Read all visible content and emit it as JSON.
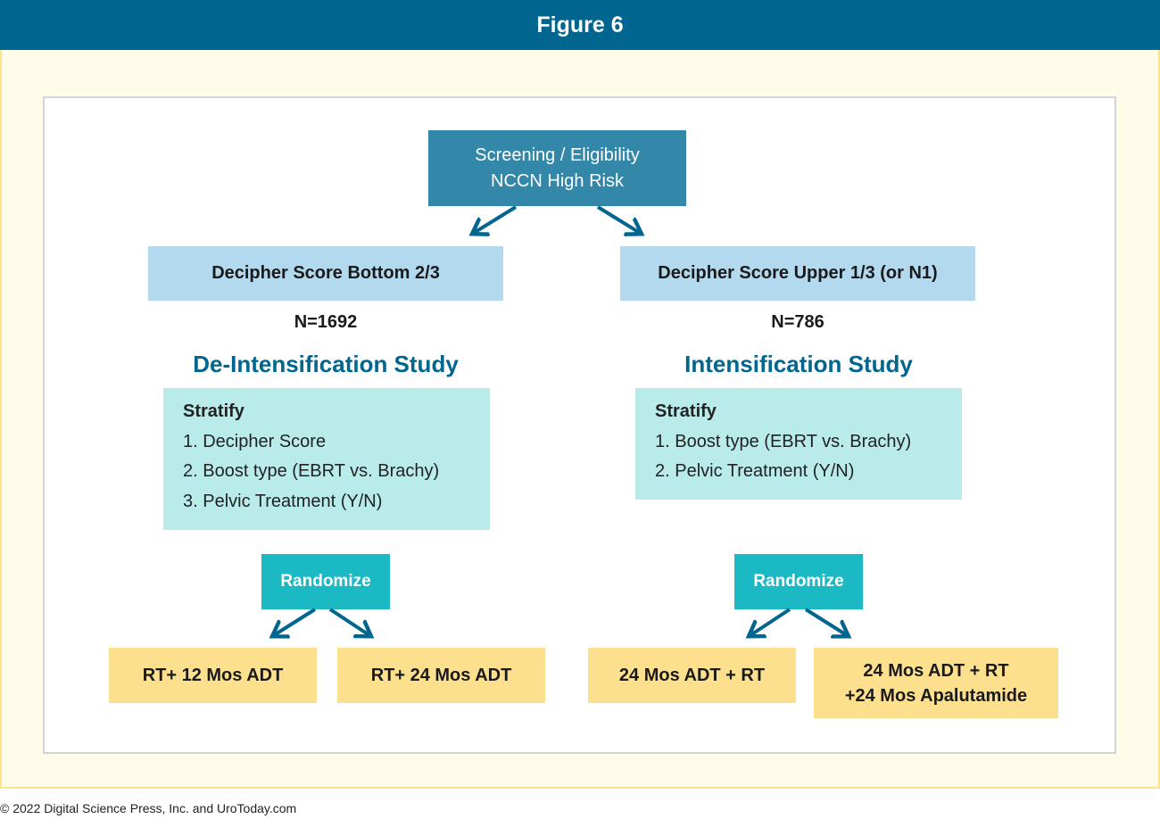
{
  "title": "Figure 6",
  "top_box": {
    "line1": "Screening / Eligibility",
    "line2": "NCCN High Risk"
  },
  "left": {
    "decipher": "Decipher Score Bottom 2/3",
    "n": "N=1692",
    "study": "De-Intensification Study",
    "stratify_title": "Stratify",
    "stratify_items": [
      "1. Decipher Score",
      "2. Boost type (EBRT vs. Brachy)",
      "3. Pelvic Treatment (Y/N)"
    ],
    "randomize": "Randomize",
    "arm1": "RT+ 12 Mos ADT",
    "arm2": "RT+ 24 Mos ADT"
  },
  "right": {
    "decipher": "Decipher Score Upper 1/3 (or N1)",
    "n": "N=786",
    "study": "Intensification Study",
    "stratify_title": "Stratify",
    "stratify_items": [
      "1. Boost type (EBRT vs. Brachy)",
      "2. Pelvic Treatment (Y/N)"
    ],
    "randomize": "Randomize",
    "arm1": "24 Mos ADT + RT",
    "arm2_line1": "24 Mos ADT + RT",
    "arm2_line2": "+24 Mos Apalutamide"
  },
  "footer": "© 2022 Digital Science Press, Inc. and UroToday.com",
  "colors": {
    "header": "#00668f",
    "top_box": "#3387a8",
    "decipher_box": "#b3d9ee",
    "stratify_box": "#b9ebeb",
    "randomize_box": "#1ab9c4",
    "arm_box": "#fde08e",
    "arrow": "#00668f"
  }
}
